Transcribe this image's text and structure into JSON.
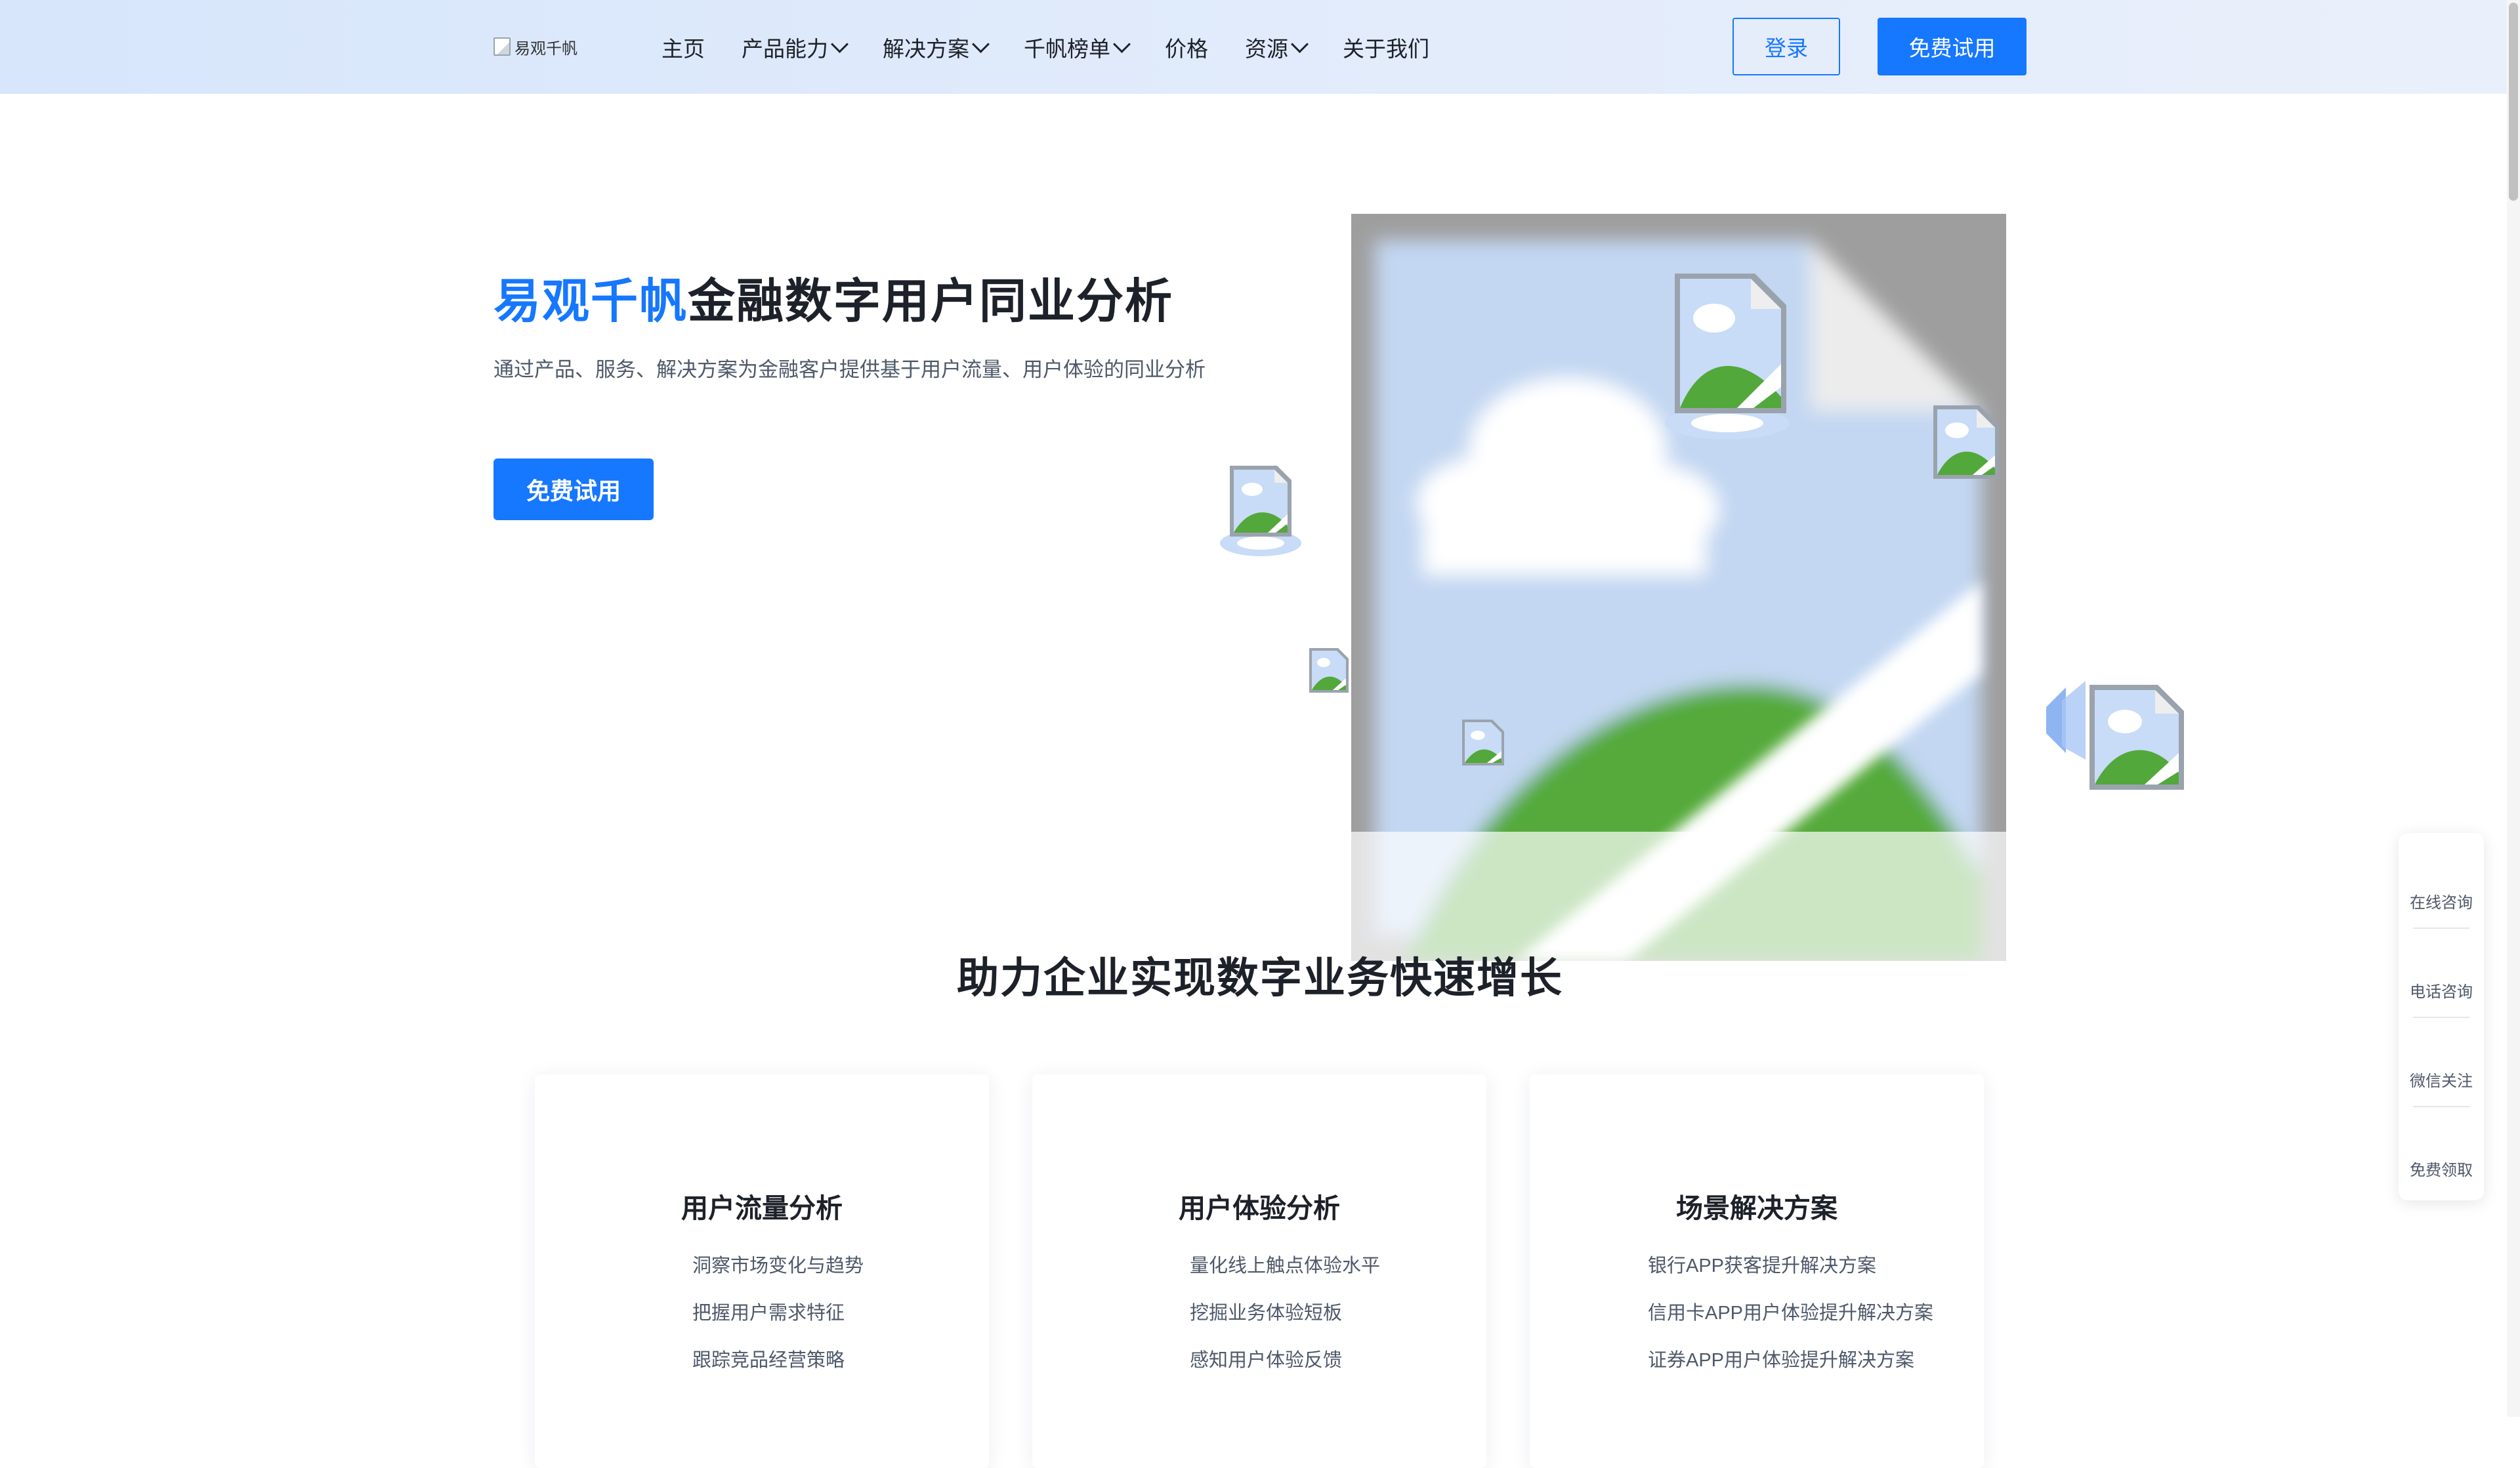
{
  "header": {
    "logo_alt": "易观千帆",
    "nav": [
      {
        "label": "主页",
        "dropdown": false
      },
      {
        "label": "产品能力",
        "dropdown": true
      },
      {
        "label": "解决方案",
        "dropdown": true
      },
      {
        "label": "千帆榜单",
        "dropdown": true
      },
      {
        "label": "价格",
        "dropdown": false
      },
      {
        "label": "资源",
        "dropdown": true
      },
      {
        "label": "关于我们",
        "dropdown": false
      }
    ],
    "login_label": "登录",
    "trial_label": "免费试用"
  },
  "hero": {
    "title_brand": "易观千帆",
    "title_rest": "金融数字用户同业分析",
    "subtitle": "通过产品、服务、解决方案为金融客户提供基于用户流量、用户体验的同业分析",
    "cta_label": "免费试用"
  },
  "section": {
    "title": "助力企业实现数字业务快速增长",
    "cards": [
      {
        "title": "用户流量分析",
        "items": [
          "洞察市场变化与趋势",
          "把握用户需求特征",
          "跟踪竞品经营策略"
        ]
      },
      {
        "title": "用户体验分析",
        "items": [
          "量化线上触点体验水平",
          "挖掘业务体验短板",
          "感知用户体验反馈"
        ]
      },
      {
        "title": "场景解决方案",
        "items": [
          "银行APP获客提升解决方案",
          "信用卡APP用户体验提升解决方案",
          "证券APP用户体验提升解决方案"
        ]
      }
    ]
  },
  "side_panel": {
    "items": [
      "在线咨询",
      "电话咨询",
      "微信关注",
      "免费领取"
    ]
  },
  "colors": {
    "accent": "#1677ff",
    "header_bg": "#dde8fb",
    "text_primary": "#1d2129",
    "text_secondary": "#4e5969"
  },
  "icons": [
    "broken-image-icon",
    "chevron-down-icon"
  ]
}
